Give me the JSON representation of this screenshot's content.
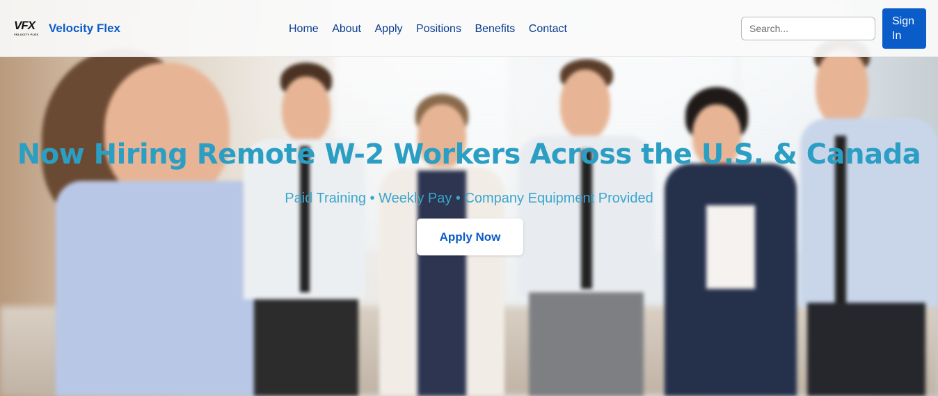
{
  "brand": {
    "logo_mark": "VFX",
    "logo_sub": "VELOCITY FLEX",
    "name": "Velocity Flex"
  },
  "nav": {
    "links": [
      "Home",
      "About",
      "Apply",
      "Positions",
      "Benefits",
      "Contact"
    ]
  },
  "search": {
    "placeholder": "Search..."
  },
  "auth": {
    "signin_line1": "Sign",
    "signin_line2": "In"
  },
  "hero": {
    "title": "Now Hiring Remote W-2 Workers Across the U.S. & Canada",
    "subtitle": "Paid Training • Weekly Pay • Company Equipment Provided",
    "cta_label": "Apply Now"
  },
  "colors": {
    "accent": "#0a5cc9",
    "nav_text": "#0a3d8f",
    "hero_title": "#2b9ec3",
    "hero_subtitle": "#3aa6cc"
  },
  "icons": {
    "logo": "vfx-logo-icon"
  }
}
